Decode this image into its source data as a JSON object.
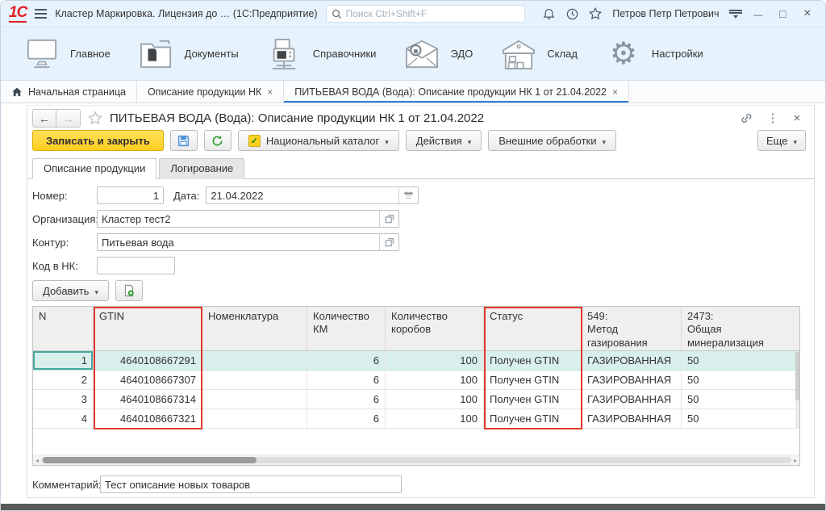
{
  "titlebar": {
    "app_title": "Кластер Маркировка. Лицензия до …  (1С:Предприятие)",
    "search_placeholder": "Поиск Ctrl+Shift+F",
    "user_name": "Петров Петр Петрович"
  },
  "ribbon": {
    "items": {
      "home": "Главное",
      "documents": "Документы",
      "catalogs": "Справочники",
      "edo": "ЭДО",
      "warehouse": "Склад",
      "settings": "Настройки"
    }
  },
  "tabs": {
    "home": "Начальная страница",
    "product_list": "Описание продукции НК",
    "product_card": "ПИТЬЕВАЯ ВОДА (Вода): Описание продукции НК 1 от 21.04.2022"
  },
  "form": {
    "title": "ПИТЬЕВАЯ ВОДА (Вода): Описание продукции НК 1 от 21.04.2022",
    "toolbar": {
      "save_close": "Записать и закрыть",
      "national_catalog": "Национальный каталог",
      "actions": "Действия",
      "external_processing": "Внешние обработки",
      "more": "Еще"
    },
    "subtabs": {
      "description": "Описание продукции",
      "logging": "Логирование"
    },
    "fields": {
      "number_label": "Номер:",
      "number_value": "1",
      "date_label": "Дата:",
      "date_value": "21.04.2022",
      "organization_label": "Организация:",
      "organization_value": "Кластер тест2",
      "contour_label": "Контур:",
      "contour_value": "Питьевая вода",
      "nk_code_label": "Код в НК:",
      "nk_code_value": "",
      "comment_label": "Комментарий:",
      "comment_value": "Тест описание новых товаров"
    },
    "add_button_label": "Добавить",
    "table": {
      "columns": [
        {
          "label": "N"
        },
        {
          "label": "GTIN"
        },
        {
          "label": "Номенклатура"
        },
        {
          "label": "Количество КМ"
        },
        {
          "label": "Количество коробов"
        },
        {
          "label": "Статус"
        },
        {
          "label": "549:",
          "sublabel": "Метод газирования"
        },
        {
          "label": "2473:",
          "sublabel": "Общая минерализация"
        }
      ],
      "rows": [
        {
          "n": "1",
          "gtin": "4640108667291",
          "nomenclature": "",
          "km_count": "6",
          "box_count": "100",
          "status": "Получен GTIN",
          "attr_549": "ГАЗИРОВАННАЯ",
          "attr_2473": "50"
        },
        {
          "n": "2",
          "gtin": "4640108667307",
          "nomenclature": "",
          "km_count": "6",
          "box_count": "100",
          "status": "Получен GTIN",
          "attr_549": "ГАЗИРОВАННАЯ",
          "attr_2473": "50"
        },
        {
          "n": "3",
          "gtin": "4640108667314",
          "nomenclature": "",
          "km_count": "6",
          "box_count": "100",
          "status": "Получен GTIN",
          "attr_549": "ГАЗИРОВАННАЯ",
          "attr_2473": "50"
        },
        {
          "n": "4",
          "gtin": "4640108667321",
          "nomenclature": "",
          "km_count": "6",
          "box_count": "100",
          "status": "Получен GTIN",
          "attr_549": "ГАЗИРОВАННАЯ",
          "attr_2473": "50"
        }
      ]
    }
  },
  "colors": {
    "titlebar_blue": "#e7f3fc",
    "accent_yellow": "#ffd21e",
    "annotation_red": "#e2392d",
    "selected_row_teal": "#d9efec",
    "active_tab_underline": "#2f7ce0"
  }
}
